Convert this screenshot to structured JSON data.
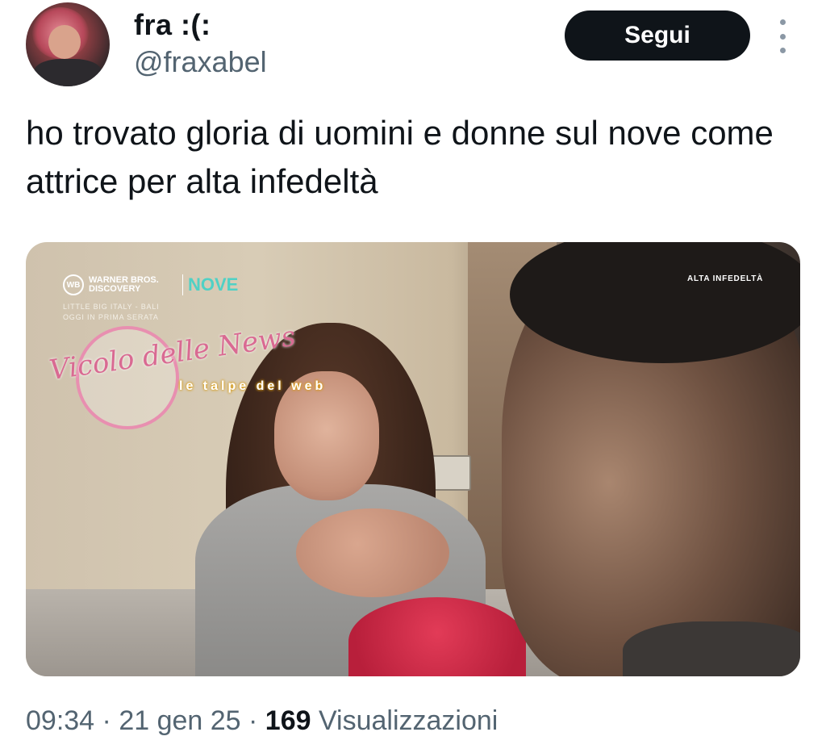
{
  "author": {
    "name": "fra :(:",
    "handle": "@fraxabel"
  },
  "actions": {
    "follow_label": "Segui",
    "more_icon": "more-vertical-icon"
  },
  "tweet": {
    "text": "ho trovato gloria di uomini e donne sul nove come attrice per alta infedeltà"
  },
  "media": {
    "brand_name": "WARNER BROS. DISCOVERY",
    "brand_icon": "WB",
    "channel": "NOVE",
    "promo_line_1": "LITTLE BIG ITALY - BALI",
    "promo_line_2": "OGGI IN PRIMA SERATA",
    "show_title": "ALTA INFEDELTÀ",
    "watermark_1": "Vicolo delle News",
    "watermark_2": "le talpe del web"
  },
  "meta": {
    "time": "09:34",
    "sep1": " · ",
    "date": "21 gen 25",
    "sep2": " · ",
    "views_count": "169",
    "views_label": " Visualizzazioni"
  },
  "colors": {
    "follow_bg": "#0f1419",
    "secondary_text": "#536471",
    "channel_accent": "#4fd1c5"
  }
}
